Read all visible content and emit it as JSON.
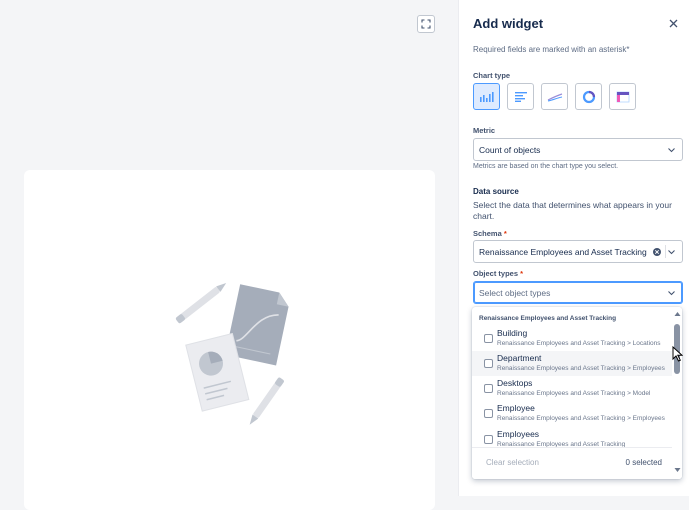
{
  "panel": {
    "title": "Add widget",
    "required_note": "Required fields are marked with an asterisk*",
    "chart_type_label": "Chart type",
    "chart_types": [
      {
        "icon": "column-chart-icon",
        "selected": true
      },
      {
        "icon": "bar-chart-icon",
        "selected": false
      },
      {
        "icon": "line-chart-icon",
        "selected": false
      },
      {
        "icon": "donut-chart-icon",
        "selected": false
      },
      {
        "icon": "table-chart-icon",
        "selected": false
      }
    ],
    "metric_label": "Metric",
    "metric_value": "Count of objects",
    "metric_helper": "Metrics are based on the chart type you select.",
    "data_source_title": "Data source",
    "data_source_desc": "Select the data that determines what appears in your chart.",
    "schema_label": "Schema",
    "schema_value": "Renaissance Employees and Asset Tracking",
    "object_types_label": "Object types",
    "object_types_placeholder": "Select object types",
    "required_marker": "*"
  },
  "dropdown": {
    "group_label": "Renaissance Employees and Asset Tracking",
    "items": [
      {
        "name": "Building",
        "path": "Renaissance Employees and Asset Tracking > Locations"
      },
      {
        "name": "Department",
        "path": "Renaissance Employees and Asset Tracking > Employees"
      },
      {
        "name": "Desktops",
        "path": "Renaissance Employees and Asset Tracking > Model"
      },
      {
        "name": "Employee",
        "path": "Renaissance Employees and Asset Tracking > Employees"
      },
      {
        "name": "Employees",
        "path": "Renaissance Employees and Asset Tracking"
      }
    ],
    "clear_selection": "Clear selection",
    "selected_count": "0 selected"
  },
  "colors": {
    "accent": "#4c9aff",
    "selected_bg": "#deebff",
    "text_primary": "#172b4d",
    "text_subtle": "#5e6c84",
    "required": "#de350b"
  }
}
